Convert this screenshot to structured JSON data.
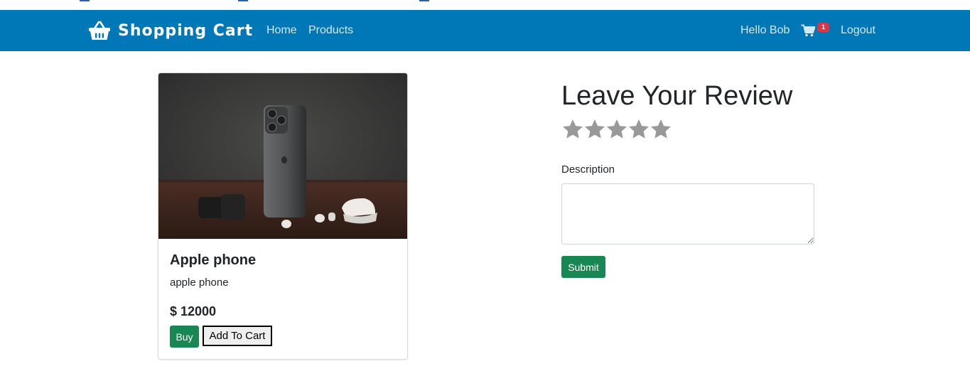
{
  "navbar": {
    "brand": "Shopping Cart",
    "brand_icon": "basket-icon",
    "links": [
      {
        "label": "Home"
      },
      {
        "label": "Products"
      }
    ],
    "greeting": "Hello Bob",
    "cart_icon": "cart-icon",
    "cart_count": "1",
    "logout": "Logout",
    "bg_color": "#0077b6"
  },
  "product": {
    "image_alt": "Apple phone",
    "title": "Apple phone",
    "description": "apple phone",
    "price": "$ 12000",
    "buy_label": "Buy",
    "add_to_cart_label": "Add To Cart"
  },
  "review": {
    "title": "Leave Your Review",
    "rating": 0,
    "max_rating": 5,
    "star_color": "#999999",
    "description_label": "Description",
    "description_value": "",
    "submit_label": "Submit"
  }
}
